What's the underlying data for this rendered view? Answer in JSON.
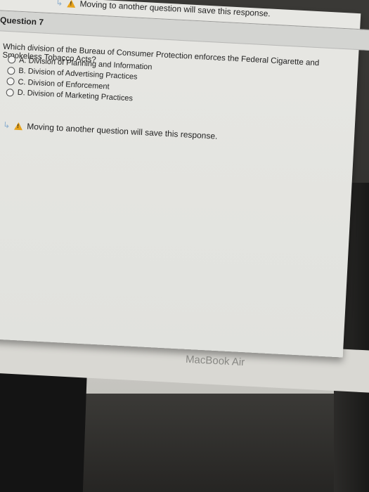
{
  "warning": {
    "top_text": "Moving to another question will save this response.",
    "bottom_text": "Moving to another question will save this response.",
    "icon": "warning-triangle-icon"
  },
  "question": {
    "title": "Question 7",
    "text": "Which division of the Bureau of Consumer Protection enforces the Federal Cigarette and Smokeless Tobacco Acts?",
    "options": [
      {
        "label": "A. Division of Planning and Information"
      },
      {
        "label": "B. Division of Advertising Practices"
      },
      {
        "label": "C. Division of Enforcement"
      },
      {
        "label": "D. Division of Marketing Practices"
      }
    ]
  },
  "device": {
    "brand": "MacBook Air"
  },
  "colors": {
    "warning": "#e6a21b",
    "page_bg": "#e4e4e0",
    "header_bg": "#d3d4d1"
  }
}
